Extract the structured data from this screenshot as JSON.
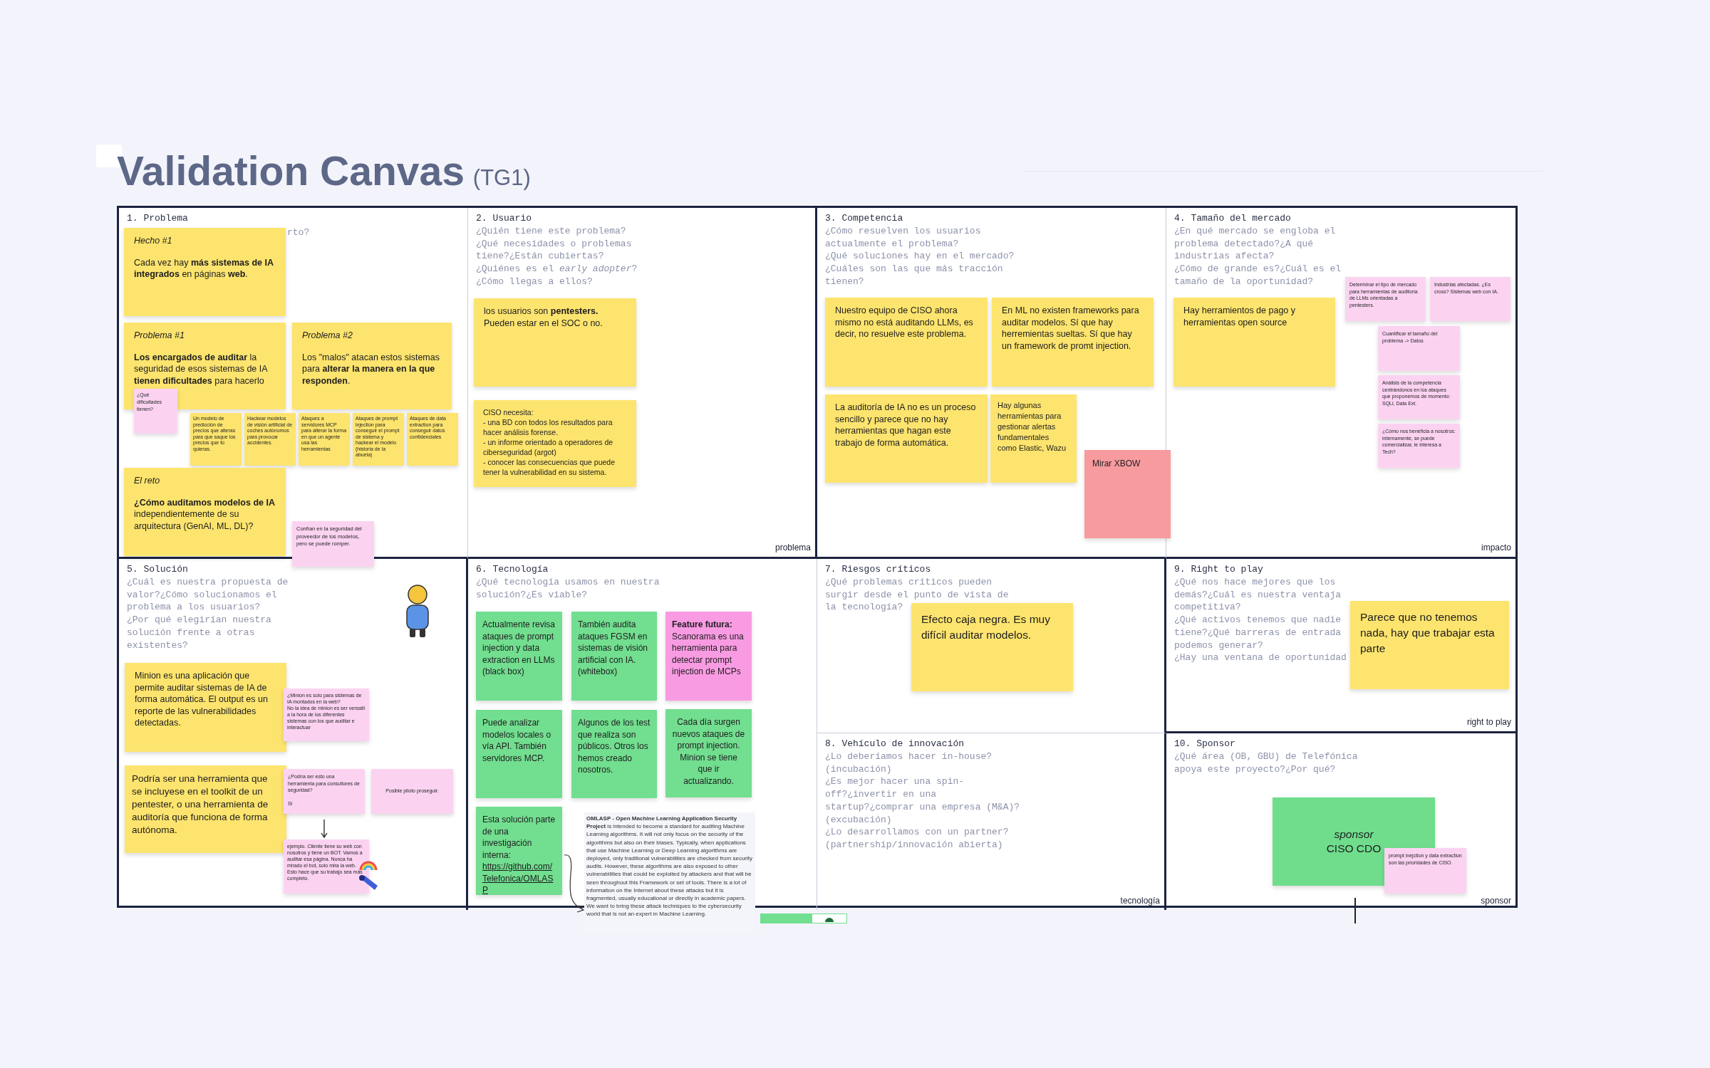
{
  "title": "Validation Canvas",
  "title_tag": "(TG1)",
  "cells": [
    {
      "heading": "1. Problema",
      "question": "rto?",
      "notes": [
        {
          "kind": "sticky",
          "color": "#fde46e",
          "label": "Hecho #1",
          "text": "Cada vez hay **más sistemas de IA integrados** en páginas **web**."
        },
        {
          "kind": "sticky",
          "color": "#fde46e",
          "label": "Problema #1",
          "text": "**Los encargados de auditar** la seguridad de esos sistemas de IA **tienen dificultades** para hacerlo"
        },
        {
          "kind": "sticky",
          "color": "#fde46e",
          "label": "Problema #2",
          "text": "Los \"malos\" atacan estos sistemas para **alterar la manera en la que responden**."
        },
        {
          "kind": "sticky",
          "color": "#fbd3f1",
          "text": "¿Qué dificultades tienen?"
        },
        {
          "kind": "sticky",
          "color": "#fde46e",
          "text": "Un modelo de predicción de precios que alteras para que saque los precios que tú quieras."
        },
        {
          "kind": "sticky",
          "color": "#fde46e",
          "text": "Hackear modelos de visión artificial de coches autónomos para provocar accidentes."
        },
        {
          "kind": "sticky",
          "color": "#fde46e",
          "text": "Ataques a servidores MCP para alterar la forma en que un agente usa las herramientas"
        },
        {
          "kind": "sticky",
          "color": "#fde46e",
          "text": "Ataques de prompt injection para conseguir el prompt de sistema y hackear el modelo (historia de la abuela)"
        },
        {
          "kind": "sticky",
          "color": "#fde46e",
          "text": "Ataques de data extraction para conseguir datos confidenciales"
        },
        {
          "kind": "sticky",
          "color": "#fde46e",
          "label": "El reto",
          "text": "**¿Cómo auditamos modelos de IA** independientemente de su arquitectura (GenAI, ML, DL)?"
        },
        {
          "kind": "sticky",
          "color": "#fbd3f1",
          "text": "Confían en la seguridad del proveedor de los modelos, pero se puede romper."
        }
      ]
    },
    {
      "heading": "2. Usuario",
      "question": "¿Quién tiene este problema?\n¿Qué necesidades o problemas\ntiene?¿Están cubiertas?\n¿Quiénes es el *early adopter*?\n¿Cómo llegas a ellos?",
      "footer": "problema",
      "notes": [
        {
          "kind": "sticky",
          "color": "#fde46e",
          "text": "los usuarios son **pentesters.**\nPueden estar en el SOC o no."
        },
        {
          "kind": "sticky",
          "color": "#fde46e",
          "text": "CISO necesita:\n- una BD con todos los resultados para hacer análisis forense.\n- un informe orientado a operadores de ciberseguridad (argot)\n - conocer las consecuencias que puede tener la vulnerabilidad en su sistema."
        }
      ]
    },
    {
      "heading": "3. Competencia",
      "question": "¿Cómo resuelven los usuarios\nactualmente el problema?\n¿Qué soluciones hay en el mercado?\n¿Cuáles son las que más tracción\ntienen?",
      "notes": [
        {
          "kind": "sticky",
          "color": "#fde46e",
          "text": "Nuestro equipo de CISO ahora mismo no está auditando LLMs, es decir, no resuelve este problema."
        },
        {
          "kind": "sticky",
          "color": "#fde46e",
          "text": "En ML no existen frameworks para auditar modelos. Sí que hay herremientas sueltas. Sí que hay un framework de promt injection."
        },
        {
          "kind": "sticky",
          "color": "#fde46e",
          "text": "La auditoría de IA no es un proceso sencillo y parece que no hay herramientas que hagan este trabajo de forma automática."
        },
        {
          "kind": "sticky",
          "color": "#fde46e",
          "text": "Hay algunas herramientas para gestionar alertas fundamentales como Elastic, Wazu"
        },
        {
          "kind": "sticky",
          "color": "#f89b9e",
          "text": "Mirar XBOW"
        }
      ]
    },
    {
      "heading": "4. Tamaño del mercado",
      "question": "¿En qué mercado se engloba el\nproblema detectado?¿A qué\nindustrias afecta?\n¿Cómo de grande es?¿Cuál es el\ntamaño de la oportunidad?",
      "footer": "impacto",
      "notes": [
        {
          "kind": "sticky",
          "color": "#fde46e",
          "text": "Hay herramientos de pago y herramientas open source"
        },
        {
          "kind": "sticky",
          "color": "#fbd3f1",
          "text": "Determinar el tipo de mercado para herramientas de auditoría de LLMs orientadas a pentesters."
        },
        {
          "kind": "sticky",
          "color": "#fbd3f1",
          "text": "Industrias afectadas. ¿Es cross? Sistemas web con IA."
        },
        {
          "kind": "sticky",
          "color": "#fbd3f1",
          "text": "Cuantificar el tamaño del problema -> Datos"
        },
        {
          "kind": "sticky",
          "color": "#fbd3f1",
          "text": "Análisis de la competencia centrándonos en los ataques que proponemos de momento: SQLi, Data Ext."
        },
        {
          "kind": "sticky",
          "color": "#fbd3f1",
          "text": "¿Cómo nos beneficia a nosotros: internamente, se puede comercializar, le interesa a Tech?"
        }
      ]
    },
    {
      "heading": "5. Solución",
      "question": "¿Cuál es nuestra propuesta de\nvalor?¿Cómo solucionamos el\nproblema a los usuarios?\n¿Por qué elegirían nuestra\nsolución frente a otras\nexistentes?",
      "notes": [
        {
          "kind": "sticky",
          "color": "#fde46e",
          "text": "Minion es una aplicación que permite auditar sistemas de IA de forma automática. El output es un reporte de las vulnerabilidades detectadas."
        },
        {
          "kind": "sticky",
          "color": "#fbd3f1",
          "text": "¿Minion es solo para sistemas de IA montados en la web?\nNo la idea de minion es ser versatil a la hora de los diferentes sistemas con los que auditar e interactuar"
        },
        {
          "kind": "sticky",
          "color": "#fde46e",
          "text": "Podría ser una herramienta que se incluyese en el toolkit de un pentester, o una herramienta de auditoría que funciona de forma autónoma."
        },
        {
          "kind": "sticky",
          "color": "#fbd3f1",
          "text": "¿Podría ser esto una herramienta para consultores de seguridad?\n\nSi"
        },
        {
          "kind": "sticky",
          "color": "#fbd3f1",
          "text": "Posible piloto proseguir."
        },
        {
          "kind": "sticky",
          "color": "#fbd3f1",
          "text": "ejemplo. Cliente tiene su web con nosotros y tiene un BOT. Vamos a auditar esa página. Nunca ha mirado el bot, solo mira la web. Esto hace que su trabajo sea más completo."
        }
      ]
    },
    {
      "heading": "6. Tecnología",
      "question": "¿Qué tecnología usamos en nuestra\nsolución?¿Es viable?",
      "notes": [
        {
          "kind": "sticky",
          "color": "#72de8f",
          "text": "Actualmente revisa ataques de prompt injection y data extraction en LLMs\n(black box)"
        },
        {
          "kind": "sticky",
          "color": "#72de8f",
          "text": "También audita ataques FGSM en sistemas de visión artificial con IA.\n(whitebox)"
        },
        {
          "kind": "sticky",
          "color": "#f99be2",
          "text": "**Feature futura:** Scanorama es una herramienta para detectar prompt injection de MCPs"
        },
        {
          "kind": "sticky",
          "color": "#72de8f",
          "text": "Puede analizar modelos locales o vía API. También servidores MCP."
        },
        {
          "kind": "sticky",
          "color": "#72de8f",
          "text": "Algunos de los test que realiza son públicos. Otros los hemos creado nosotros."
        },
        {
          "kind": "sticky",
          "color": "#72de8f",
          "text": "Cada día surgen nuevos ataques de prompt injection. Minion se tiene que ir actualizando."
        },
        {
          "kind": "sticky",
          "color": "#72de8f",
          "text": "Esta solución parte de una investigación interna:",
          "link": "https://github.com/Telefonica/OMLASP"
        },
        {
          "kind": "text",
          "text": "**OMLASP - Open Machine Learning Application Security Project** is intended to become a standard for auditing Machine Learning algorithms. It will not only focus on the security of the algorithms but also on their biases. Typically, when applications that use Machine Learning or Deep Learning algorithms are deployed, only traditional vulnerabilities are checked from security audits. However, these algorithms are also exposed to other vulnerabilities that could be exploited by attackers and that will be seen throughout this Framework or set of tools. There is a lot of information on the Internet about these attacks but it is fragmented, usually educational or directly in academic papers. We want to bring these attack techniques to the cybersecurity world that is not an expert in Machine Learning."
        }
      ]
    },
    {
      "heading": "7. Riesgos críticos",
      "question": "¿Qué problemas críticos pueden\nsurgir desde el punto de vista de\nla tecnología?",
      "notes": [
        {
          "kind": "sticky",
          "color": "#fde46e",
          "text": "Efecto caja negra. Es muy difícil auditar modelos."
        }
      ]
    },
    {
      "heading": "9. Right to play",
      "question": "¿Qué nos hace mejores que los\ndemás?¿Cuál es nuestra ventaja\ncompetitiva?\n¿Qué activos tenemos que nadie\ntiene?¿Qué barreras de entrada\npodemos generar?\n¿Hay una ventana de oportunidad",
      "footer": "right to play",
      "notes": [
        {
          "kind": "sticky",
          "color": "#fde46e",
          "text": "Parece que no tenemos nada, hay que trabajar esta parte"
        }
      ]
    },
    {
      "heading": "8. Vehículo de innovación",
      "question": "¿Lo deberíamos hacer in-house?\n(incubación)\n¿Es mejor hacer una spin-\noff?¿invertir en una\nstartup?¿comprar una empresa (M&A)?\n(excubación)\n¿Lo desarrollamos con un partner?\n(partnership/innovación abierta)",
      "footer": "tecnología"
    },
    {
      "heading": "10. Sponsor",
      "question": "¿Qué área (OB, GBU) de Telefónica\napoya este proyecto?¿Por qué?",
      "footer": "sponsor",
      "notes": [
        {
          "kind": "sticky",
          "color": "#6fdd8c",
          "label": "sponsor",
          "text": "CISO  CDO"
        },
        {
          "kind": "sticky",
          "color": "#fbd3f1",
          "text": "prompt inejction y data extraction son las prioridades de CISO."
        }
      ]
    }
  ]
}
